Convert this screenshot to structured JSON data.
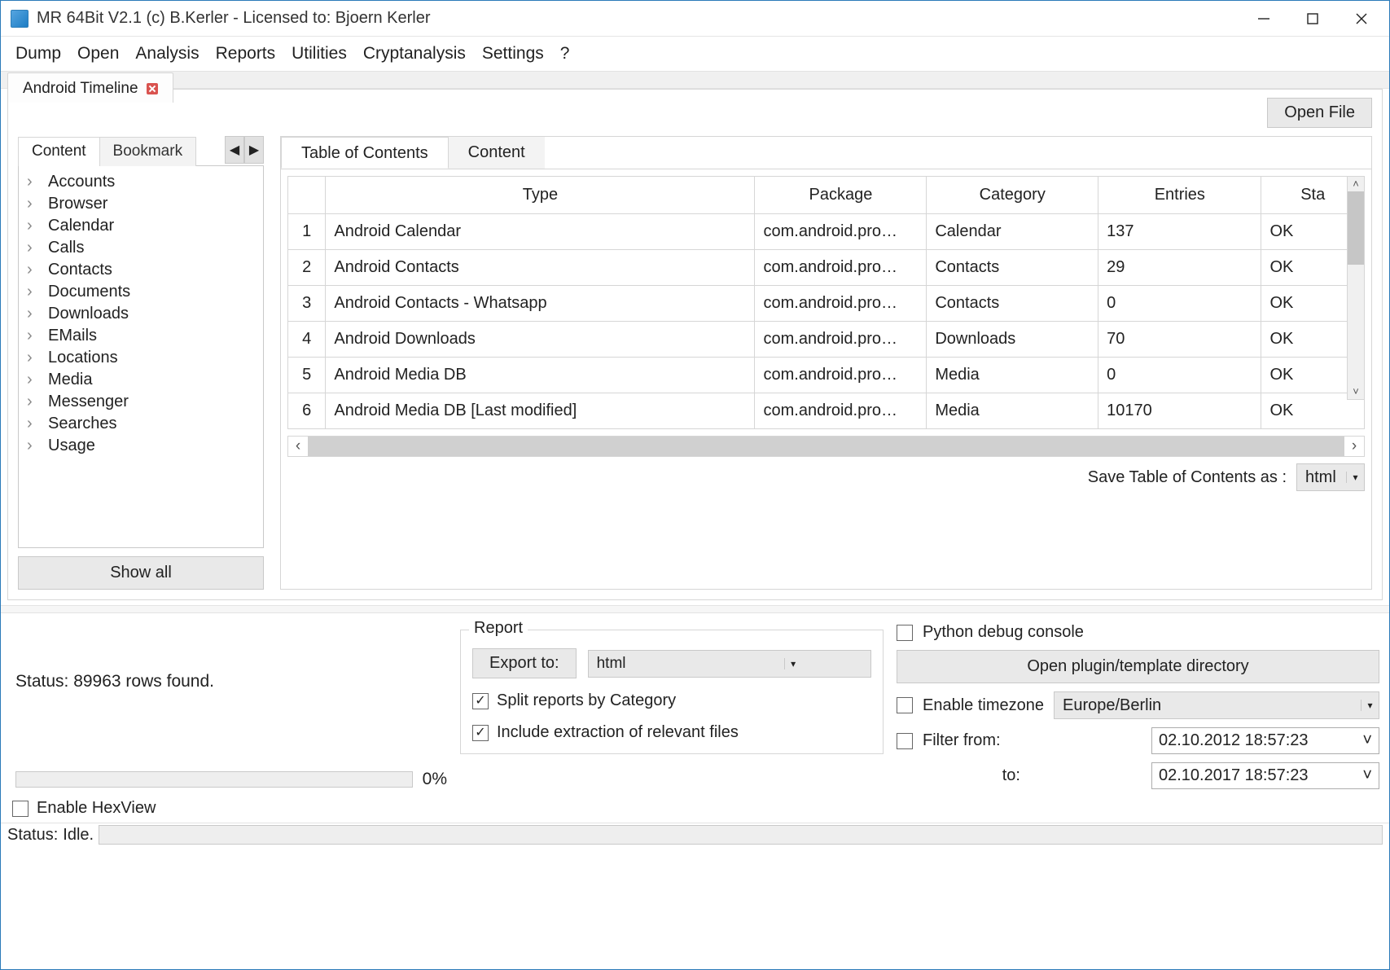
{
  "window": {
    "title": "MR 64Bit V2.1 (c) B.Kerler - Licensed to: Bjoern Kerler"
  },
  "menu": {
    "items": [
      "Dump",
      "Open",
      "Analysis",
      "Reports",
      "Utilities",
      "Cryptanalysis",
      "Settings",
      "?"
    ]
  },
  "doc_tab": {
    "label": "Android Timeline"
  },
  "buttons": {
    "open_file": "Open File",
    "show_all": "Show all",
    "export_to": "Export to:",
    "open_plugin_dir": "Open plugin/template directory"
  },
  "left_tabs": {
    "active": "Content",
    "inactive": "Bookmark"
  },
  "tree": {
    "items": [
      "Accounts",
      "Browser",
      "Calendar",
      "Calls",
      "Contacts",
      "Documents",
      "Downloads",
      "EMails",
      "Locations",
      "Media",
      "Messenger",
      "Searches",
      "Usage"
    ]
  },
  "right_tabs": {
    "active": "Table of Contents",
    "inactive": "Content"
  },
  "table": {
    "headers": {
      "type": "Type",
      "package": "Package",
      "category": "Category",
      "entries": "Entries",
      "status": "Sta"
    },
    "rows": [
      {
        "n": "1",
        "type": "Android Calendar",
        "package": "com.android.pro…",
        "category": "Calendar",
        "entries": "137",
        "status": "OK"
      },
      {
        "n": "2",
        "type": "Android Contacts",
        "package": "com.android.pro…",
        "category": "Contacts",
        "entries": "29",
        "status": "OK"
      },
      {
        "n": "3",
        "type": "Android Contacts - Whatsapp",
        "package": "com.android.pro…",
        "category": "Contacts",
        "entries": "0",
        "status": "OK"
      },
      {
        "n": "4",
        "type": "Android Downloads",
        "package": "com.android.pro…",
        "category": "Downloads",
        "entries": "70",
        "status": "OK"
      },
      {
        "n": "5",
        "type": "Android Media DB",
        "package": "com.android.pro…",
        "category": "Media",
        "entries": "0",
        "status": "OK"
      },
      {
        "n": "6",
        "type": "Android Media DB [Last modified]",
        "package": "com.android.pro…",
        "category": "Media",
        "entries": "10170",
        "status": "OK"
      }
    ]
  },
  "save_toc": {
    "label": "Save Table of Contents as :",
    "value": "html"
  },
  "status_rows": "Status: 89963 rows found.",
  "progress": {
    "pct": "0%"
  },
  "report": {
    "legend": "Report",
    "export_format": "html",
    "split": "Split reports by Category",
    "include": "Include extraction of relevant files"
  },
  "python_debug": "Python debug console",
  "timezone": {
    "label": "Enable timezone",
    "value": "Europe/Berlin"
  },
  "filter": {
    "from_label": "Filter from:",
    "to_label": "to:",
    "from": "02.10.2012 18:57:23",
    "to": "02.10.2017 18:57:23"
  },
  "hexview": "Enable HexView",
  "statusbar": {
    "label": "Status:",
    "value": "Idle."
  }
}
